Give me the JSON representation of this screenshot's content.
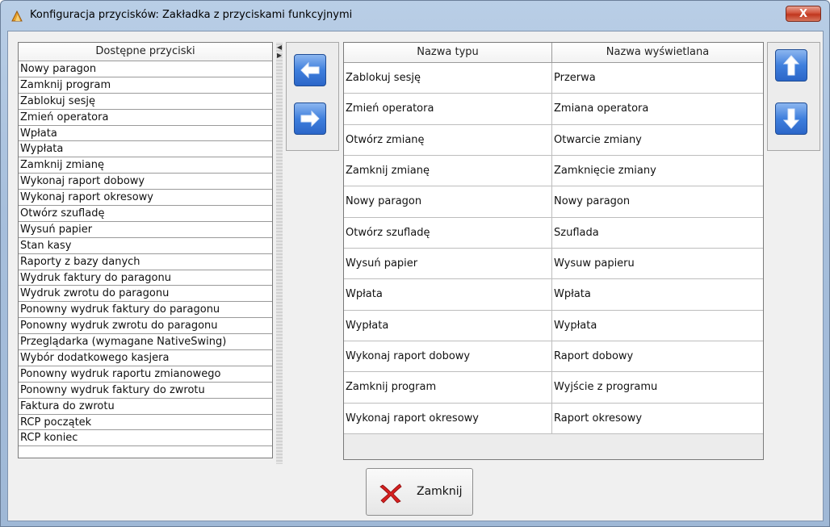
{
  "window": {
    "title": "Konfiguracja przycisków: Zakładka z przyciskami funkcyjnymi",
    "close_label": "X"
  },
  "available": {
    "header": "Dostępne przyciski",
    "items": [
      "Nowy paragon",
      "Zamknij program",
      "Zablokuj sesję",
      "Zmień operatora",
      "Wpłata",
      "Wypłata",
      "Zamknij zmianę",
      "Wykonaj raport dobowy",
      "Wykonaj raport okresowy",
      "Otwórz szufladę",
      "Wysuń papier",
      "Stan kasy",
      "Raporty z bazy danych",
      "Wydruk faktury do paragonu",
      "Wydruk zwrotu do paragonu",
      "Ponowny wydruk faktury do paragonu",
      "Ponowny wydruk zwrotu do paragonu",
      "Przeglądarka (wymagane  NativeSwing)",
      "Wybór dodatkowego kasjera",
      "Ponowny wydruk raportu zmianowego",
      "Ponowny wydruk faktury do zwrotu",
      "Faktura do zwrotu",
      "RCP początek",
      "RCP koniec"
    ]
  },
  "table": {
    "col1": "Nazwa typu",
    "col2": "Nazwa wyświetlana",
    "rows": [
      {
        "type": "Zablokuj sesję",
        "display": "Przerwa"
      },
      {
        "type": "Zmień operatora",
        "display": "Zmiana operatora"
      },
      {
        "type": "Otwórz zmianę",
        "display": "Otwarcie zmiany"
      },
      {
        "type": "Zamknij zmianę",
        "display": "Zamknięcie zmiany"
      },
      {
        "type": "Nowy paragon",
        "display": "Nowy paragon"
      },
      {
        "type": "Otwórz szufladę",
        "display": "Szuflada"
      },
      {
        "type": "Wysuń papier",
        "display": "Wysuw papieru"
      },
      {
        "type": "Wpłata",
        "display": "Wpłata"
      },
      {
        "type": "Wypłata",
        "display": "Wypłata"
      },
      {
        "type": "Wykonaj raport dobowy",
        "display": "Raport dobowy"
      },
      {
        "type": "Zamknij program",
        "display": "Wyjście z programu"
      },
      {
        "type": "Wykonaj raport okresowy",
        "display": "Raport okresowy"
      }
    ]
  },
  "footer": {
    "close_label": "Zamknij"
  },
  "icons": {
    "remove": "arrow-left-icon",
    "add": "arrow-right-icon",
    "up": "arrow-up-icon",
    "down": "arrow-down-icon",
    "close": "red-x-icon"
  }
}
